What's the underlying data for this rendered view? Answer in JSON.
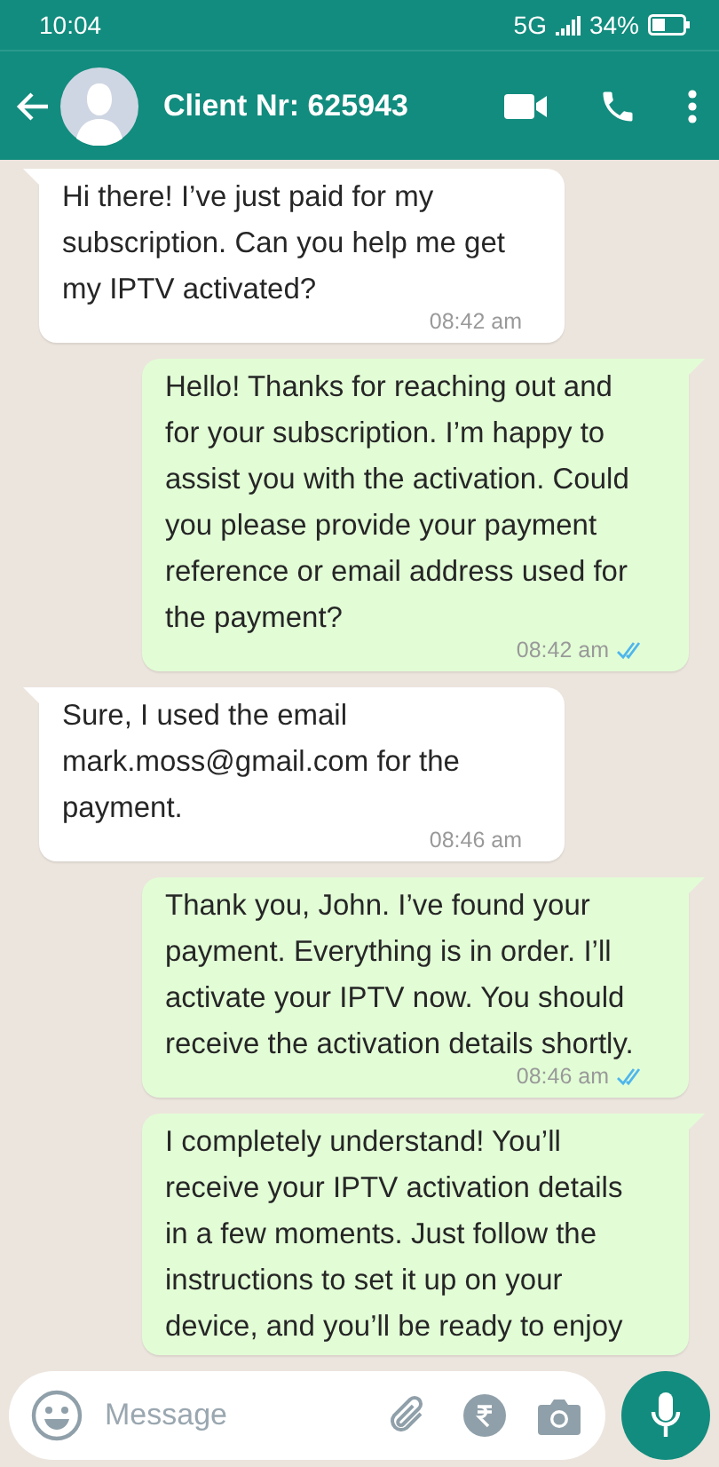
{
  "status_bar": {
    "time": "10:04",
    "network": "5G",
    "battery": "34%"
  },
  "header": {
    "title": "Client Nr: 625943"
  },
  "messages": [
    {
      "kind": "incoming",
      "text": "Hi there! I’ve just paid for my subscription. Can you help me get my IPTV activated?",
      "time": "08:42 am",
      "read": false
    },
    {
      "kind": "outgoing",
      "text": "Hello! Thanks for reaching out and for your subscription. I’m happy to assist you with the activation. Could you please provide your payment reference or email address used for the payment?",
      "time": "08:42 am",
      "read": true
    },
    {
      "kind": "incoming",
      "text": "Sure, I used the email mark.moss@gmail.com for the payment.",
      "time": "08:46 am",
      "read": false
    },
    {
      "kind": "outgoing",
      "text": "Thank you, John. I’ve found your payment. Everything is in order. I’ll activate your IPTV now. You should receive the activation details shortly.",
      "time": "08:46 am",
      "read": true
    },
    {
      "kind": "outgoing",
      "text": "I completely understand! You’ll receive your IPTV activation details in a few moments. Just follow the instructions to set it up on your device, and you’ll be ready to enjoy"
    }
  ],
  "composer": {
    "placeholder": "Message"
  }
}
